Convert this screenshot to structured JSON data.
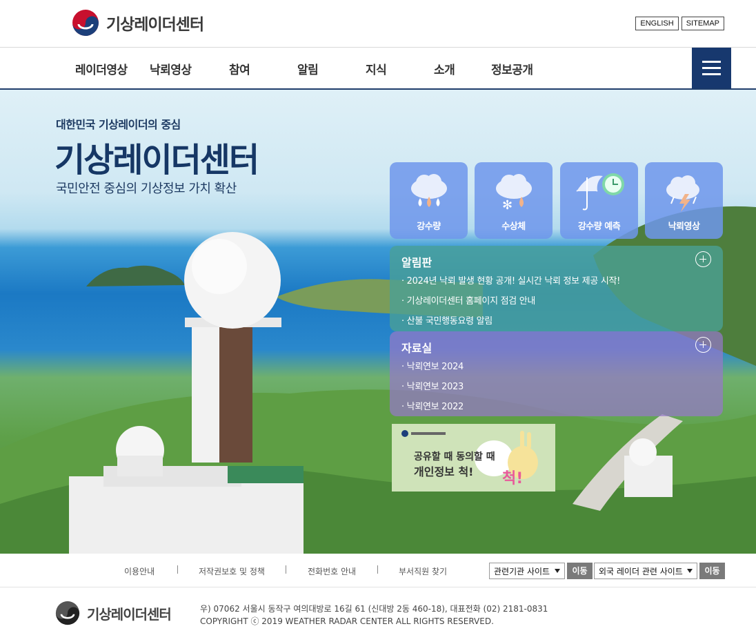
{
  "header": {
    "site_name": "기상레이더센터",
    "util_links": [
      "ENGLISH",
      "SITEMAP"
    ]
  },
  "nav": {
    "items": [
      "레이더영상",
      "낙뢰영상",
      "참여",
      "알림",
      "지식",
      "소개",
      "정보공개"
    ]
  },
  "hero": {
    "subtitle": "대한민국 기상레이더의 중심",
    "title": "기상레이더센터",
    "description": "국민안전 중심의 기상정보 가치 확산"
  },
  "quick_tiles": [
    {
      "label": "강수량",
      "icon": "rain-cloud-icon"
    },
    {
      "label": "수상체",
      "icon": "snow-rain-cloud-icon"
    },
    {
      "label": "강수량 예측",
      "icon": "umbrella-clock-icon"
    },
    {
      "label": "낙뢰영상",
      "icon": "lightning-cloud-icon"
    }
  ],
  "notice_board": {
    "title": "알림판",
    "items": [
      "· 2024년 낙뢰 발생 현황 공개! 실시간 낙뢰 정보 제공 시작!",
      "· 기상레이더센터 홈페이지 점검 안내",
      "· 산불 국민행동요령 알림"
    ]
  },
  "data_room": {
    "title": "자료실",
    "items": [
      "· 낙뢰연보 2024",
      "· 낙뢰연보 2023",
      "· 낙뢰연보 2022"
    ]
  },
  "banner": {
    "line1": "공유할 때 동의할 때",
    "line2": "개인정보 척!"
  },
  "footer_nav": {
    "links": [
      "이용안내",
      "저작권보호 및 정책",
      "전화번호 안내",
      "부서직원 찾기"
    ],
    "select1": "관련기관 사이트",
    "select2": "외국 레이더 관련 사이트",
    "go_label": "이동"
  },
  "footer": {
    "site_name": "기상레이더센터",
    "address": "우) 07062 서울시 동작구 여의대방로 16길 61 (신대방 2동 460-18), 대표전화 (02) 2181-0831",
    "copyright": "COPYRIGHT ⓒ 2019 WEATHER RADAR CENTER ALL RIGHTS RESERVED."
  },
  "colors": {
    "nav_accent": "#17386e",
    "title_navy": "#163765",
    "tile_blue": "#6e96eb",
    "notice_teal": "#4aa096",
    "data_purple": "#9678c8"
  }
}
